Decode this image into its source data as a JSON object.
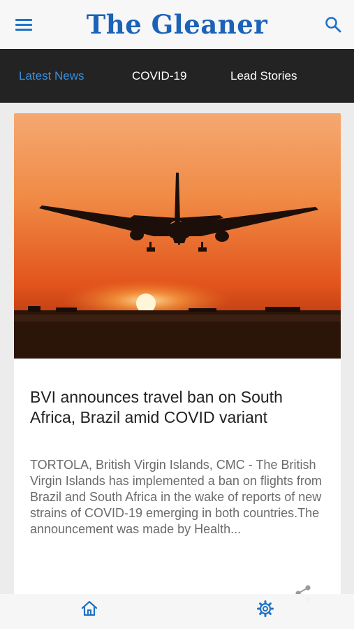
{
  "header": {
    "brand": "The Gleaner",
    "menu_icon": "hamburger-menu-icon",
    "search_icon": "search-icon",
    "accent_color": "#1b62b8"
  },
  "tabs": [
    {
      "label": "Latest News",
      "active": true
    },
    {
      "label": "COVID-19",
      "active": false
    },
    {
      "label": "Lead Stories",
      "active": false
    }
  ],
  "article": {
    "image_subject": "airplane silhouette landing at sunset",
    "headline": "BVI announces travel ban on South Africa, Brazil amid COVID variant",
    "excerpt": "TORTOLA, British Virgin Islands, CMC - The British Virgin Islands has implemented a ban on flights from Brazil and South Africa in the wake of reports of new strains of COVID-19 emerging in both countries.The announcement was made by Health...",
    "share_icon": "share-icon"
  },
  "bottom_nav": {
    "home_icon": "home-icon",
    "settings_icon": "gear-icon"
  }
}
